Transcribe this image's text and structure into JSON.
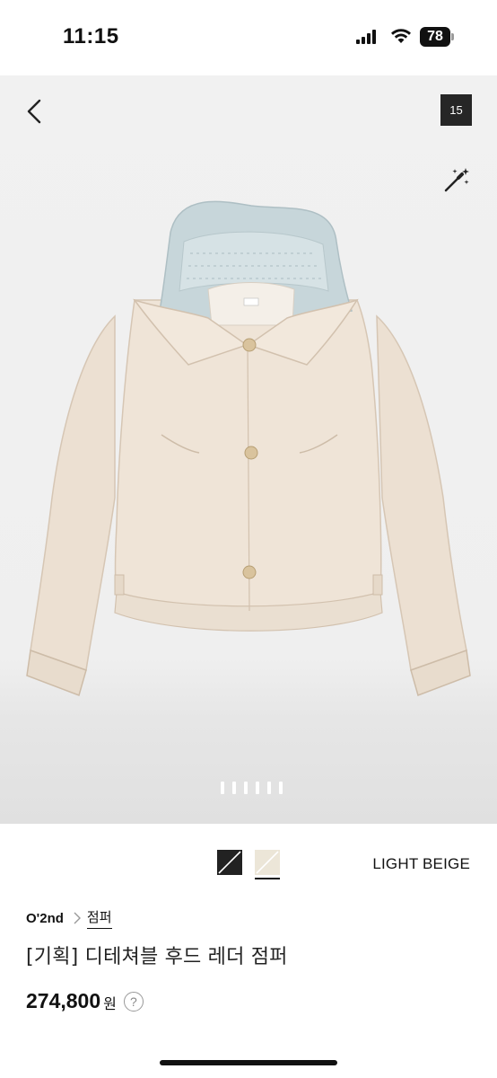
{
  "status_bar": {
    "time": "11:15",
    "battery": "78"
  },
  "image_viewer": {
    "counter": "15",
    "dot_count": 6,
    "active_dot": 0,
    "icons": [
      "back-arrow-icon",
      "magic-wand-icon"
    ]
  },
  "colors": {
    "selected_name": "LIGHT BEIGE",
    "swatches": [
      {
        "name": "dark",
        "color": "#222222",
        "selected": false
      },
      {
        "name": "light-beige",
        "color": "#ece6d8",
        "selected": true
      }
    ]
  },
  "product": {
    "brand": "O'2nd",
    "category": "점퍼",
    "title": "[기획] 디테쳐블 후드 레더 점퍼",
    "price": "274,800",
    "price_unit": "원",
    "help_symbol": "?"
  }
}
